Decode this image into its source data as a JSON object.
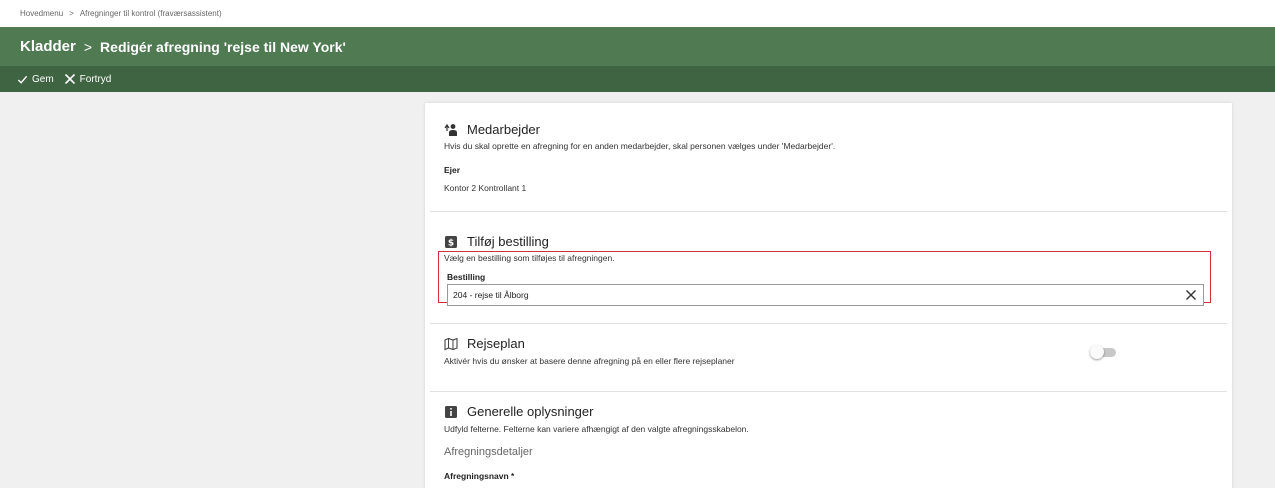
{
  "breadcrumb": {
    "home": "Hovedmenu",
    "separator": ">",
    "current": "Afregninger til kontrol (fraværsassistent)"
  },
  "titlebar": {
    "root": "Kladder",
    "separator": ">",
    "current": "Redigér afregning 'rejse til New York'"
  },
  "toolbar": {
    "save_label": "Gem",
    "cancel_label": "Fortryd"
  },
  "sections": {
    "employee": {
      "title": "Medarbejder",
      "description": "Hvis du skal oprette en afregning for en anden medarbejder, skal personen vælges under 'Medarbejder'.",
      "owner_label": "Ejer",
      "owner_value": "Kontor 2 Kontrollant 1"
    },
    "order": {
      "title": "Tilføj bestilling",
      "description": "Vælg en bestilling som tilføjes til afregningen.",
      "field_label": "Bestilling",
      "field_value": "204 - rejse til Ålborg"
    },
    "travelplan": {
      "title": "Rejseplan",
      "description": "Aktivér hvis du ønsker at basere denne afregning på en eller flere rejseplaner",
      "toggle_on": false
    },
    "general": {
      "title": "Generelle oplysninger",
      "description": "Udfyld felterne. Felterne kan variere afhængigt af den valgte afregningsskabelon.",
      "subheading": "Afregningsdetaljer",
      "first_field_label": "Afregningsnavn *"
    }
  },
  "colors": {
    "header_green": "#4f7a52",
    "toolbar_green": "#3f6441",
    "highlight_red": "#d0313d"
  },
  "icons": {
    "save": "checkmark-icon",
    "cancel": "close-icon",
    "employee": "people-icon",
    "order": "dollar-icon",
    "travelplan": "map-icon",
    "general": "info-icon"
  }
}
